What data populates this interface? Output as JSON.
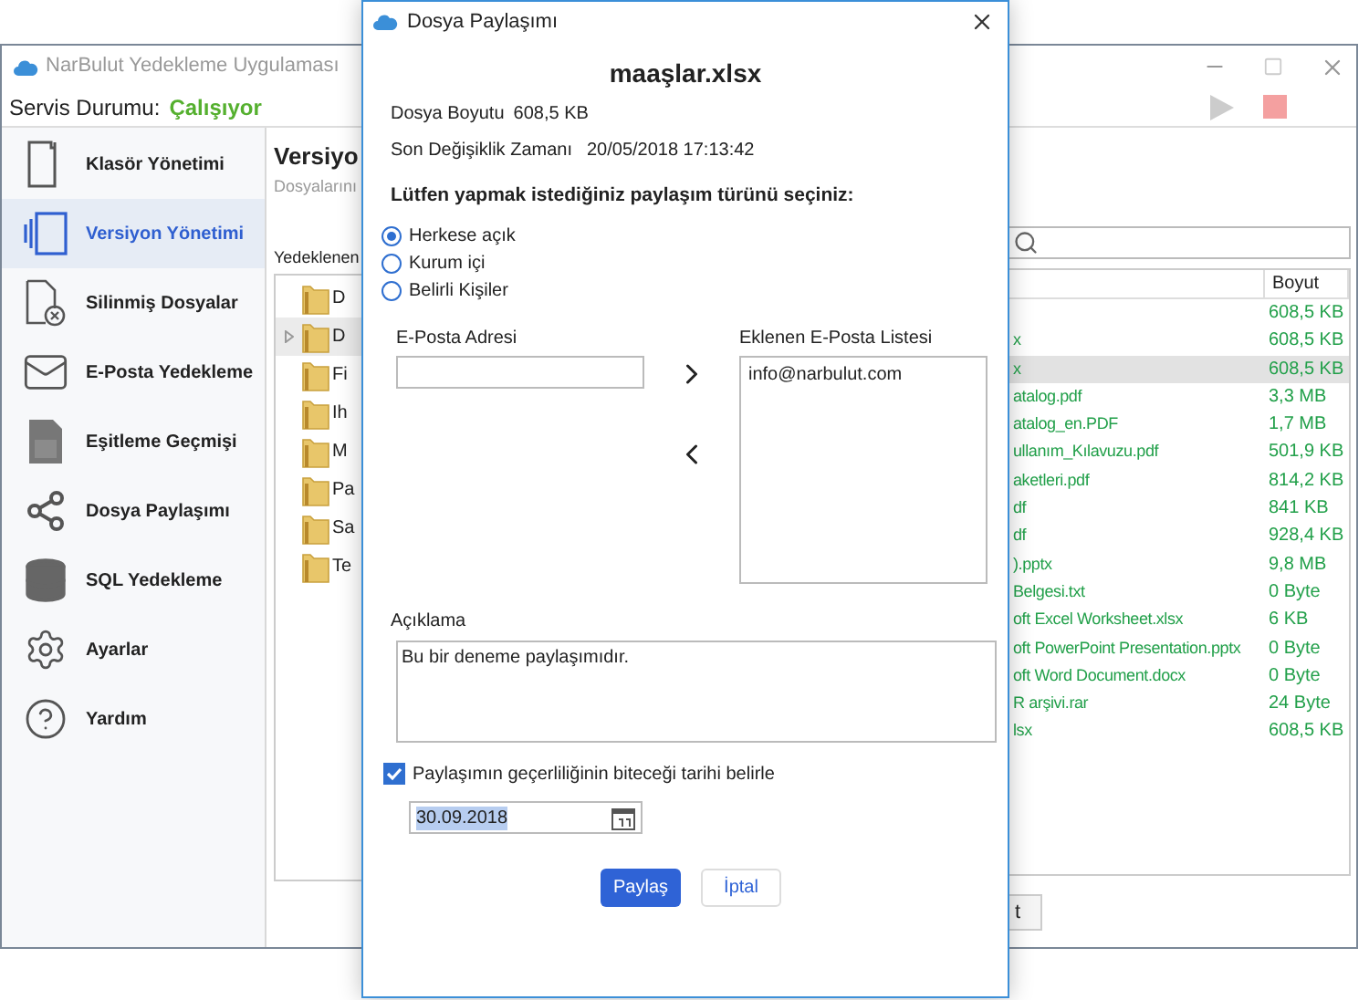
{
  "app_window": {
    "title": "NarBulut Yedekleme Uygulaması"
  },
  "service_status": {
    "label": "Servis Durumu:",
    "value": "Çalışıyor",
    "running": true
  },
  "sidebar": {
    "items": [
      {
        "label": "Klasör Yönetimi",
        "selected": false
      },
      {
        "label": "Versiyon Yönetimi",
        "selected": true
      },
      {
        "label": "Silinmiş Dosyalar",
        "selected": false
      },
      {
        "label": "E-Posta Yedekleme",
        "selected": false
      },
      {
        "label": "Eşitleme Geçmişi",
        "selected": false
      },
      {
        "label": "Dosya Paylaşımı",
        "selected": false
      },
      {
        "label": "SQL Yedekleme",
        "selected": false
      },
      {
        "label": "Ayarlar",
        "selected": false
      },
      {
        "label": "Yardım",
        "selected": false
      }
    ]
  },
  "main": {
    "heading": "Versiyo",
    "subtitle": "Dosyalarını",
    "tree_label": "Yedeklenen",
    "tree": [
      {
        "label": "D",
        "selected": false,
        "expandable": false
      },
      {
        "label": "D",
        "selected": true,
        "expandable": true
      },
      {
        "label": "Fi",
        "selected": false,
        "expandable": false
      },
      {
        "label": "Ih",
        "selected": false,
        "expandable": false
      },
      {
        "label": "M",
        "selected": false,
        "expandable": false
      },
      {
        "label": "Pa",
        "selected": false,
        "expandable": false
      },
      {
        "label": "Sa",
        "selected": false,
        "expandable": false
      },
      {
        "label": "Te",
        "selected": false,
        "expandable": false
      }
    ],
    "file_table": {
      "columns": [
        "Boyut"
      ],
      "rows": [
        {
          "size": "608,5 KB",
          "selected": false
        },
        {
          "name": "x",
          "size": "608,5 KB",
          "selected": false
        },
        {
          "name": "x",
          "size": "608,5 KB",
          "selected": true
        },
        {
          "name": "atalog.pdf",
          "size": "3,3 MB",
          "selected": false
        },
        {
          "name": "atalog_en.PDF",
          "size": "1,7 MB",
          "selected": false
        },
        {
          "name": "ullanım_Kılavuzu.pdf",
          "size": "501,9 KB",
          "selected": false
        },
        {
          "name": "aketleri.pdf",
          "size": "814,2 KB",
          "selected": false
        },
        {
          "name": "df",
          "size": "841 KB",
          "selected": false
        },
        {
          "name": "df",
          "size": "928,4 KB",
          "selected": false
        },
        {
          "name": ").pptx",
          "size": "9,8 MB",
          "selected": false
        },
        {
          "name": "Belgesi.txt",
          "size": "0 Byte",
          "selected": false
        },
        {
          "name": "oft Excel Worksheet.xlsx",
          "size": "6 KB",
          "selected": false
        },
        {
          "name": "oft PowerPoint Presentation.pptx",
          "size": "0 Byte",
          "selected": false
        },
        {
          "name": "oft Word Document.docx",
          "size": "0 Byte",
          "selected": false
        },
        {
          "name": "R arşivi.rar",
          "size": "24 Byte",
          "selected": false
        },
        {
          "name": "lsx",
          "size": "608,5 KB",
          "selected": false
        }
      ]
    },
    "bottom_button": "t"
  },
  "dialog": {
    "title": "Dosya Paylaşımı",
    "file_name": "maaşlar.xlsx",
    "info": [
      {
        "label": "Dosya Boyutu",
        "value": "608,5 KB"
      },
      {
        "label": "Son Değişiklik Zamanı",
        "value": "20/05/2018 17:13:42"
      }
    ],
    "prompt": "Lütfen yapmak istediğiniz paylaşım türünü seçiniz:",
    "share_types": [
      {
        "label": "Herkese açık",
        "selected": true
      },
      {
        "label": "Kurum içi",
        "selected": false
      },
      {
        "label": "Belirli Kişiler",
        "selected": false
      }
    ],
    "email_label": "E-Posta Adresi",
    "list_label": "Eklenen E-Posta Listesi",
    "emails": [
      "info@narbulut.com"
    ],
    "description_label": "Açıklama",
    "description": "Bu bir deneme paylaşımıdır.",
    "expiry": {
      "label": "Paylaşımın geçerliliğinin biteceği tarihi belirle",
      "checked": true,
      "date": "30.09.2018",
      "date_highlighted": true
    },
    "buttons": [
      {
        "label": "Paylaş",
        "kind": "primary"
      },
      {
        "label": "İptal",
        "kind": "secondary"
      }
    ]
  }
}
